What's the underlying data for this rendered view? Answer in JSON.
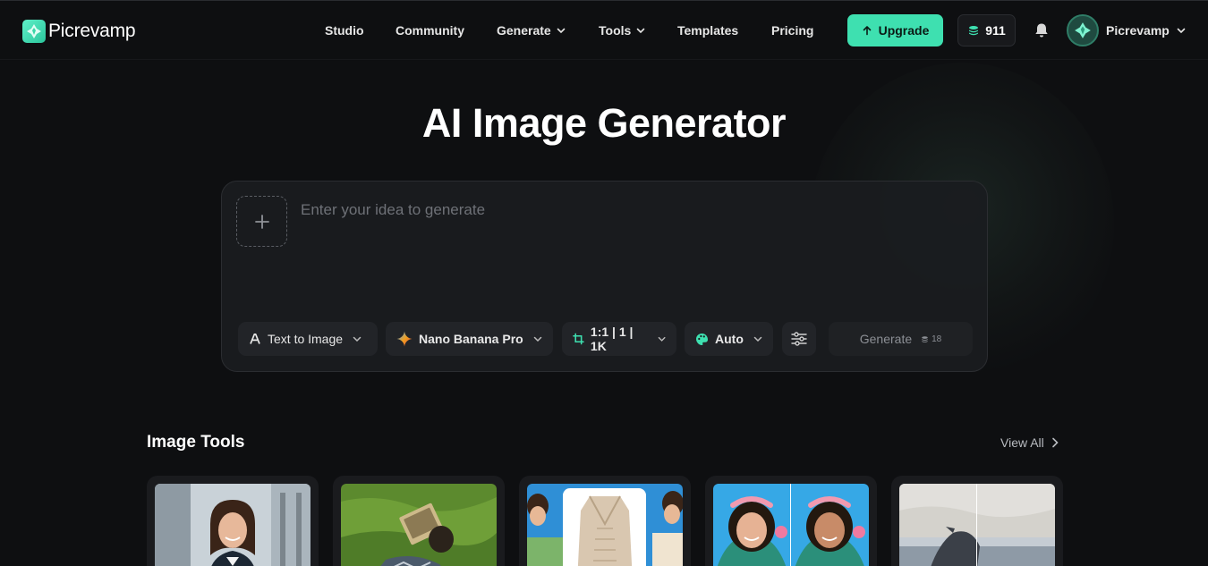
{
  "brand": {
    "name": "Picrevamp",
    "accent": "#3ee0b0"
  },
  "nav": {
    "items": [
      {
        "label": "Studio",
        "has_dropdown": false
      },
      {
        "label": "Community",
        "has_dropdown": false
      },
      {
        "label": "Generate",
        "has_dropdown": true
      },
      {
        "label": "Tools",
        "has_dropdown": true
      },
      {
        "label": "Templates",
        "has_dropdown": false
      },
      {
        "label": "Pricing",
        "has_dropdown": false
      }
    ],
    "upgrade_label": "Upgrade",
    "credits": "911",
    "user_name": "Picrevamp"
  },
  "hero": {
    "title": "AI Image Generator"
  },
  "prompt": {
    "placeholder": "Enter your idea to generate",
    "mode": "Text to Image",
    "model": "Nano Banana Pro",
    "size": "1:1 | 1 | 1K",
    "style": "Auto",
    "generate_label": "Generate",
    "generate_cost": "18"
  },
  "tools_section": {
    "title": "Image Tools",
    "view_all": "View All",
    "cards": [
      {
        "icon": "portrait-thumbnail"
      },
      {
        "icon": "grass-book-thumbnail"
      },
      {
        "icon": "cardigan-thumbnail"
      },
      {
        "icon": "before-after-portrait-thumbnail"
      },
      {
        "icon": "before-after-whale-thumbnail"
      }
    ]
  }
}
